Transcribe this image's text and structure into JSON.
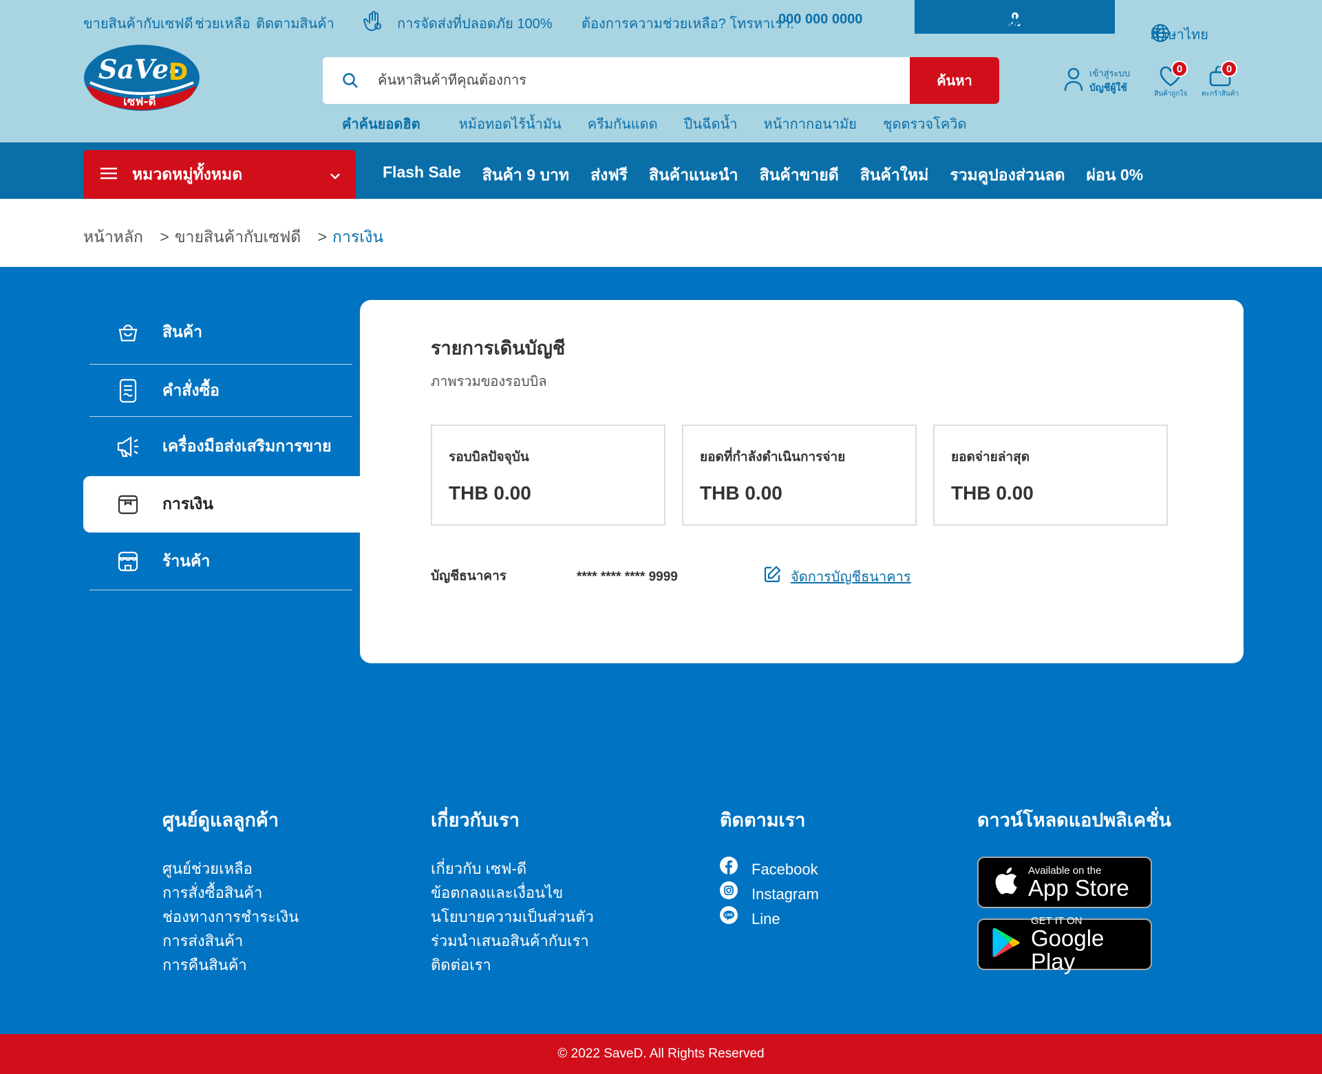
{
  "util": {
    "sell": "ขายสินค้ากับเซฟดี",
    "help": "ช่วยเหลือ",
    "track": "ติดตามสินค้า",
    "safe": "การจัดส่งที่ปลอดภัย 100%",
    "need_help": "ต้องการความช่วยเหลือ? โทรหาเรา:",
    "phone": "000 000 0000",
    "login": "ลงชื่อเข้าใช้",
    "divider": "I",
    "register": "สมัครสมาชิก",
    "language": "ภาษาไทย"
  },
  "logo": {
    "main": "SaVe-D",
    "sub": "เซฟ-ดี"
  },
  "search": {
    "placeholder": "ค้นหาสินค้าที่คุณต้องการ",
    "button": "ค้นหา"
  },
  "hot": {
    "label": "คำค้นยอดฮิต",
    "items": [
      "หม้อทอดไร้น้ำมัน",
      "ครีมกันแดด",
      "ปืนฉีดน้ำ",
      "หน้ากากอนามัย",
      "ชุดตรวจโควิด"
    ]
  },
  "account": {
    "line1": "เข้าสู่ระบบ",
    "line2": "บัญชีผู้ใช้",
    "wishlist_label": "สินค้าถูกใจ",
    "wishlist_count": "0",
    "cart_label": "ตะกร้าสินค้า",
    "cart_count": "0"
  },
  "nav": {
    "categories": "หมวดหมู่ทั้งหมด",
    "links": [
      "Flash Sale",
      "สินค้า 9 บาท",
      "ส่งฟรี",
      "สินค้าแนะนำ",
      "สินค้าขายดี",
      "สินค้าใหม่",
      "รวมคูปองส่วนลด",
      "ผ่อน 0%"
    ]
  },
  "breadcrumb": {
    "home": "หน้าหลัก",
    "sep": ">",
    "parent": "ขายสินค้ากับเซฟดี",
    "current": "การเงิน"
  },
  "sidebar": {
    "items": [
      {
        "label": "สินค้า",
        "icon": "bag-icon"
      },
      {
        "label": "คำสั่งซื้อ",
        "icon": "order-document-icon"
      },
      {
        "label": "เครื่องมือส่งเสริมการขาย",
        "icon": "megaphone-icon"
      },
      {
        "label": "การเงิน",
        "icon": "wallet-icon"
      },
      {
        "label": "ร้านค้า",
        "icon": "store-icon"
      }
    ],
    "active": "การเงิน"
  },
  "finance": {
    "title": "รายการเดินบัญชี",
    "subtitle": "ภาพรวมของรอบบิล",
    "cards": [
      {
        "label": "รอบบิลปัจจุบัน",
        "value": "THB 0.00"
      },
      {
        "label": "ยอดที่กำลังดำเนินการจ่าย",
        "value": "THB 0.00"
      },
      {
        "label": "ยอดจ่ายล่าสุด",
        "value": "THB 0.00"
      }
    ],
    "bank_label": "บัญชีธนาคาร",
    "bank_number": "**** **** **** 9999",
    "manage_bank": "จัดการบัญชีธนาคาร"
  },
  "footer": {
    "care": {
      "title": "ศูนย์ดูแลลูกค้า",
      "links": [
        "ศูนย์ช่วยเหลือ",
        "การสั่งซื้อสินค้า",
        "ช่องทางการชำระเงิน",
        "การส่งสินค้า",
        "การคืนสินค้า"
      ]
    },
    "about": {
      "title": "เกี่ยวกับเรา",
      "links": [
        "เกี่ยวกับ เซฟ-ดี",
        "ข้อตกลงและเงื่อนไข",
        "นโยบายความเป็นส่วนตัว",
        "ร่วมนำเสนอสินค้ากับเรา",
        "ติดต่อเรา"
      ]
    },
    "follow": {
      "title": "ติดตามเรา",
      "links": [
        "Facebook",
        "Instagram",
        "Line"
      ]
    },
    "app": {
      "title": "ดาวน์โหลดแอปพลิเคชั่น",
      "appstore_small": "Available on the",
      "appstore_big": "App Store",
      "gplay_small": "GET IT ON",
      "gplay_big": "Google Play"
    },
    "copyright": "© 2022 SaveD. All Rights Reserved"
  },
  "colors": {
    "brand_blue": "#0a6fa9",
    "page_blue": "#0073c2",
    "light_blue": "#a9d4e2",
    "red": "#d10f1b"
  }
}
